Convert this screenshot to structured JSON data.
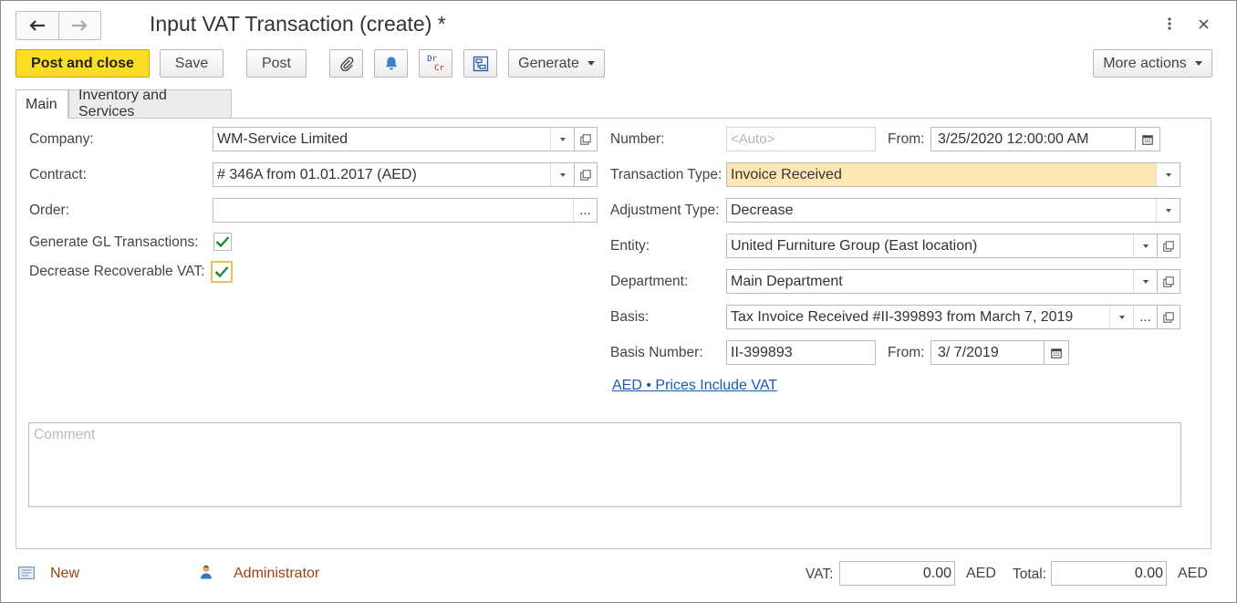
{
  "window": {
    "title": "Input VAT Transaction (create) *"
  },
  "toolbar": {
    "post_and_close": "Post and close",
    "save": "Save",
    "post": "Post",
    "dr_label": "Dr",
    "cr_label": "Cr",
    "generate": "Generate",
    "more_actions": "More actions"
  },
  "tabs": [
    {
      "label": "Main",
      "active": true
    },
    {
      "label": "Inventory and Services",
      "active": false
    }
  ],
  "left": {
    "company_label": "Company:",
    "company_value": "WM-Service Limited",
    "contract_label": "Contract:",
    "contract_value": "# 346A from 01.01.2017 (AED)",
    "order_label": "Order:",
    "order_value": "",
    "generate_gl_label": "Generate GL Transactions:",
    "generate_gl_checked": true,
    "decrease_vat_label": "Decrease Recoverable VAT:",
    "decrease_vat_checked": true
  },
  "right": {
    "number_label": "Number:",
    "number_placeholder": "<Auto>",
    "from_label": "From:",
    "from_value": "3/25/2020 12:00:00 AM",
    "transaction_type_label": "Transaction Type:",
    "transaction_type_value": "Invoice Received",
    "adjustment_type_label": "Adjustment Type:",
    "adjustment_type_value": "Decrease",
    "entity_label": "Entity:",
    "entity_value": "United Furniture Group (East location)",
    "department_label": "Department:",
    "department_value": "Main Department",
    "basis_label": "Basis:",
    "basis_value": "Tax Invoice Received #II-399893 from March 7, 2019",
    "basis_number_label": "Basis Number:",
    "basis_number_value": "II-399893",
    "basis_from_label": "From:",
    "basis_from_value": "3/ 7/2019",
    "currency_link": "AED • Prices Include VAT"
  },
  "comment": {
    "placeholder": "Comment"
  },
  "footer": {
    "status": "New",
    "user": "Administrator",
    "vat_label": "VAT:",
    "vat_value": "0.00",
    "vat_currency": "AED",
    "total_label": "Total:",
    "total_value": "0.00",
    "total_currency": "AED"
  },
  "colors": {
    "primary_button": "#fcdd23",
    "highlight_field": "#fde8b5",
    "link": "#1c5ba8",
    "footer_link": "#9e3f0a",
    "check": "#1a8a3a"
  }
}
